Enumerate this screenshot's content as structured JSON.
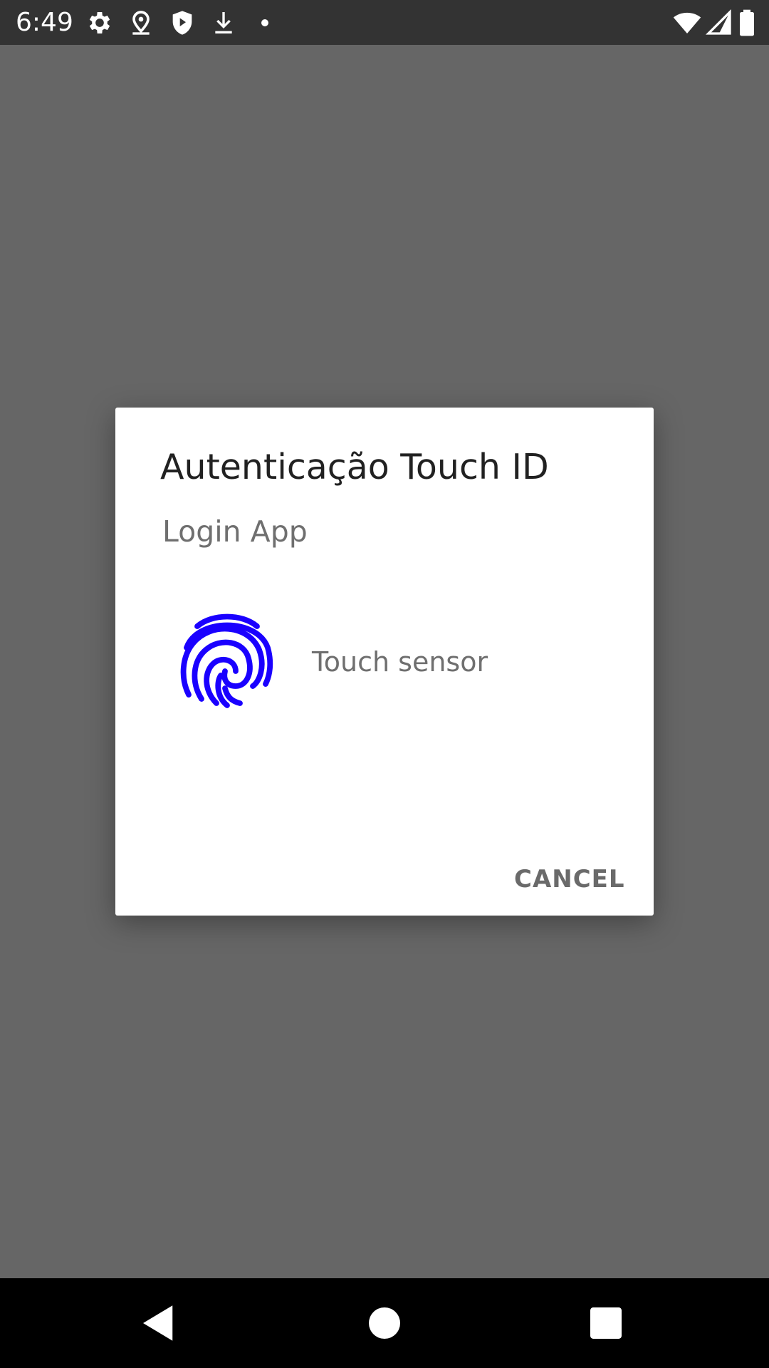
{
  "status_bar": {
    "time": "6:49",
    "icons_left": [
      "settings-icon",
      "location-icon",
      "shield-icon",
      "download-icon",
      "dot-icon"
    ],
    "icons_right": [
      "wifi-icon",
      "signal-icon",
      "battery-icon"
    ]
  },
  "dialog": {
    "title": "Autenticação Touch ID",
    "subtitle": "Login App",
    "sensor_label": "Touch sensor",
    "cancel_label": "CANCEL",
    "icon": "fingerprint-icon",
    "icon_color": "#1a00ff"
  },
  "nav_bar": {
    "buttons": [
      "back-icon",
      "home-icon",
      "recents-icon"
    ]
  },
  "colors": {
    "scrim": "#666666",
    "status_bar": "#333333",
    "nav_bar": "#000000",
    "dialog_bg": "#ffffff"
  }
}
